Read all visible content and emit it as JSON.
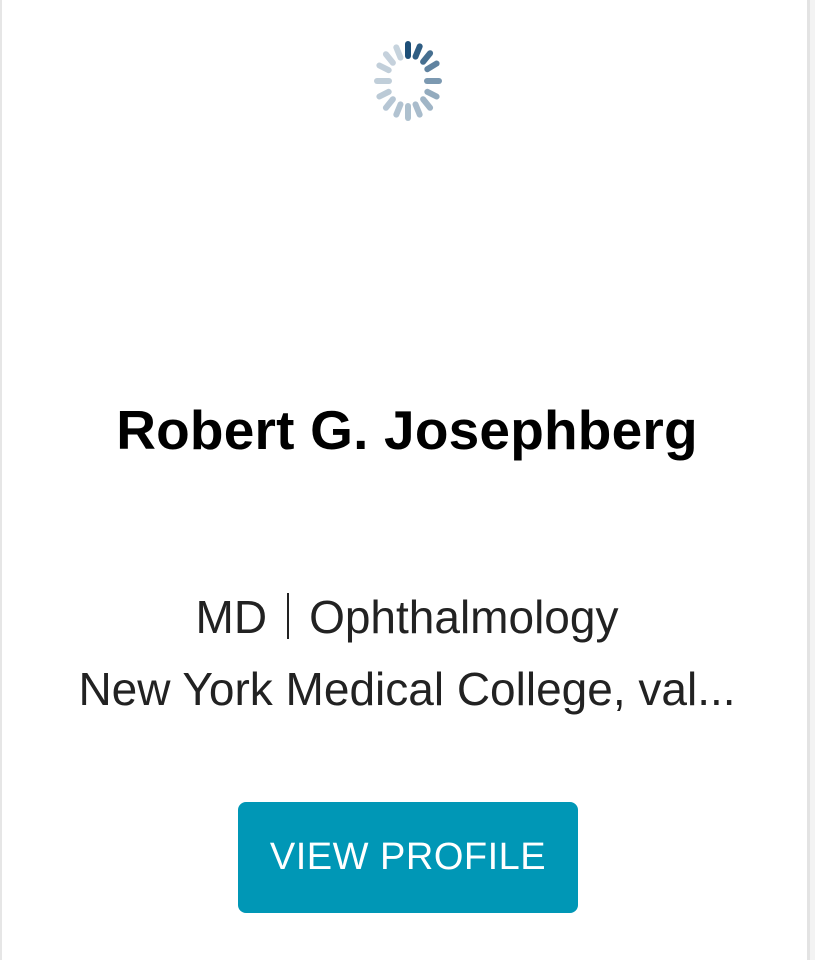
{
  "profile": {
    "loading_icon": "loading-spinner-icon",
    "name": "Robert G. Josephberg",
    "degree": "MD",
    "specialty": "Ophthalmology",
    "school": "New York Medical College, val..."
  },
  "actions": {
    "view_profile_label": "VIEW PROFILE"
  },
  "colors": {
    "button": "#0097b6",
    "spinner": "#1d4f78"
  }
}
